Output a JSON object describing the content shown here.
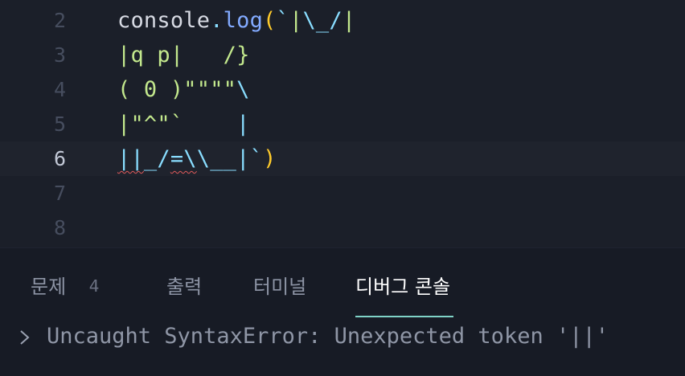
{
  "editor": {
    "lines": [
      {
        "number": "2",
        "current": false,
        "tokens": [
          {
            "text": "console",
            "kind": "ident"
          },
          {
            "text": ".",
            "kind": "dot"
          },
          {
            "text": "log",
            "kind": "method"
          },
          {
            "text": "(",
            "kind": "paren"
          },
          {
            "text": "`",
            "kind": "tick"
          },
          {
            "text": "|",
            "kind": "str"
          },
          {
            "text": "\\_/",
            "kind": "escape"
          },
          {
            "text": "|",
            "kind": "str"
          }
        ]
      },
      {
        "number": "3",
        "current": false,
        "tokens": [
          {
            "text": "|q p|   /}",
            "kind": "str"
          }
        ]
      },
      {
        "number": "4",
        "current": false,
        "tokens": [
          {
            "text": "( 0 )\"\"\"\"",
            "kind": "str"
          },
          {
            "text": "\\",
            "kind": "escape"
          }
        ]
      },
      {
        "number": "5",
        "current": false,
        "tokens": [
          {
            "text": "|\"^\"`",
            "kind": "str"
          },
          {
            "text": "    |",
            "kind": "escape"
          }
        ]
      },
      {
        "number": "6",
        "current": true,
        "tokens": [
          {
            "text": "||",
            "kind": "escape",
            "error": true
          },
          {
            "text": "_/",
            "kind": "escape"
          },
          {
            "text": "=\\",
            "kind": "escape",
            "error": true
          },
          {
            "text": "\\__|",
            "kind": "escape"
          },
          {
            "text": "`",
            "kind": "tick"
          },
          {
            "text": ")",
            "kind": "paren"
          }
        ]
      },
      {
        "number": "7",
        "current": false,
        "tokens": []
      },
      {
        "number": "8",
        "current": false,
        "tokens": []
      }
    ]
  },
  "panel": {
    "tabs": [
      {
        "id": "problems",
        "label": "문제",
        "badge": "4",
        "active": false
      },
      {
        "id": "output",
        "label": "출력",
        "active": false
      },
      {
        "id": "terminal",
        "label": "터미널",
        "active": false
      },
      {
        "id": "debug-console",
        "label": "디버그 콘솔",
        "active": true
      }
    ],
    "console": {
      "expand_icon": "chevron-right-icon",
      "message": "Uncaught SyntaxError: Unexpected token '||'"
    }
  },
  "colors": {
    "background": "#171b25",
    "editor_background": "#1b1f29",
    "current_line": "#1f232d",
    "string": "#c3e88d",
    "escape": "#89ddff",
    "method": "#82aaff",
    "paren": "#ffcb2b",
    "active_tab_underline": "#7fd3c7",
    "error_squiggle": "#e05a5a"
  }
}
